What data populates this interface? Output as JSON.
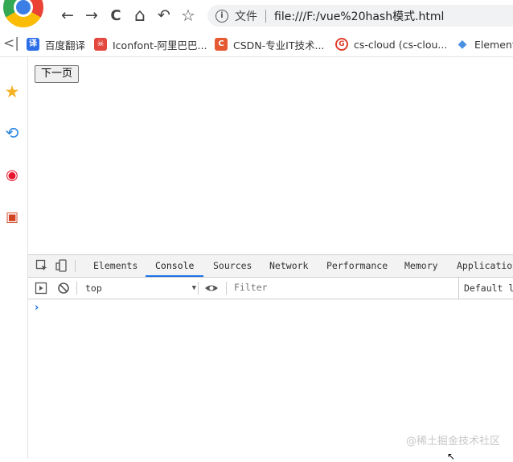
{
  "nav": {
    "back_icon": "←",
    "forward_icon": "→",
    "reload_icon": "C",
    "home_icon": "⌂",
    "undo_icon": "↶",
    "star_icon": "☆",
    "address": {
      "info_icon": "i",
      "scheme_label": "文件",
      "url": "file:///F:/vue%20hash模式.html"
    }
  },
  "bookmarks": {
    "collapse_icon": "<|",
    "items": [
      {
        "label": "百度翻译",
        "icon_char": "译",
        "icon_color": "#2b6ee8"
      },
      {
        "label": "Iconfont-阿里巴巴...",
        "icon_char": "☠",
        "icon_color": "#e4473d"
      },
      {
        "label": "CSDN-专业IT技术...",
        "icon_char": "C",
        "icon_color": "#e55a30"
      },
      {
        "label": "cs-cloud (cs-clou...",
        "icon_char": "G",
        "icon_color": "#e0402f"
      },
      {
        "label": "Element",
        "icon_char": "◆",
        "icon_color": "#4a90e2"
      }
    ]
  },
  "sidebar": {
    "favorites_icon": "★",
    "history_icon": "⟲",
    "weibo_icon": "◉",
    "office_icon": "▣"
  },
  "page": {
    "next_button": "下一页"
  },
  "devtools": {
    "tabs": [
      "Elements",
      "Console",
      "Sources",
      "Network",
      "Performance",
      "Memory",
      "Application"
    ],
    "active_tab": "Console",
    "context": "top",
    "filter_placeholder": "Filter",
    "levels_label": "Default levels",
    "prompt_symbol": "›"
  },
  "watermark": "@稀土掘金技术社区",
  "colors": {
    "accent": "#1a73e8",
    "favorites": "#f5b225",
    "history": "#2e86de",
    "weibo": "#e6162d",
    "office": "#d04423"
  }
}
